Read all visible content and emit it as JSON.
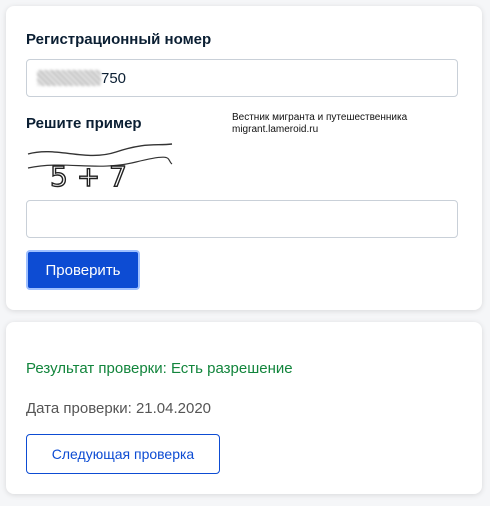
{
  "form": {
    "reg_number_label": "Регистрационный номер",
    "reg_number_value_visible": "750",
    "captcha_label": "Решите пример",
    "captcha_text": "5 + 7",
    "watermark_line1": "Вестник мигранта и путешественника",
    "watermark_line2": "migrant.lameroid.ru",
    "captcha_answer_value": "",
    "submit_label": "Проверить"
  },
  "result": {
    "status_text": "Результат проверки: Есть разрешение",
    "date_text": "Дата проверки: 21.04.2020",
    "next_check_label": "Следующая проверка"
  },
  "colors": {
    "primary": "#0d4cd3",
    "success": "#12853c"
  }
}
